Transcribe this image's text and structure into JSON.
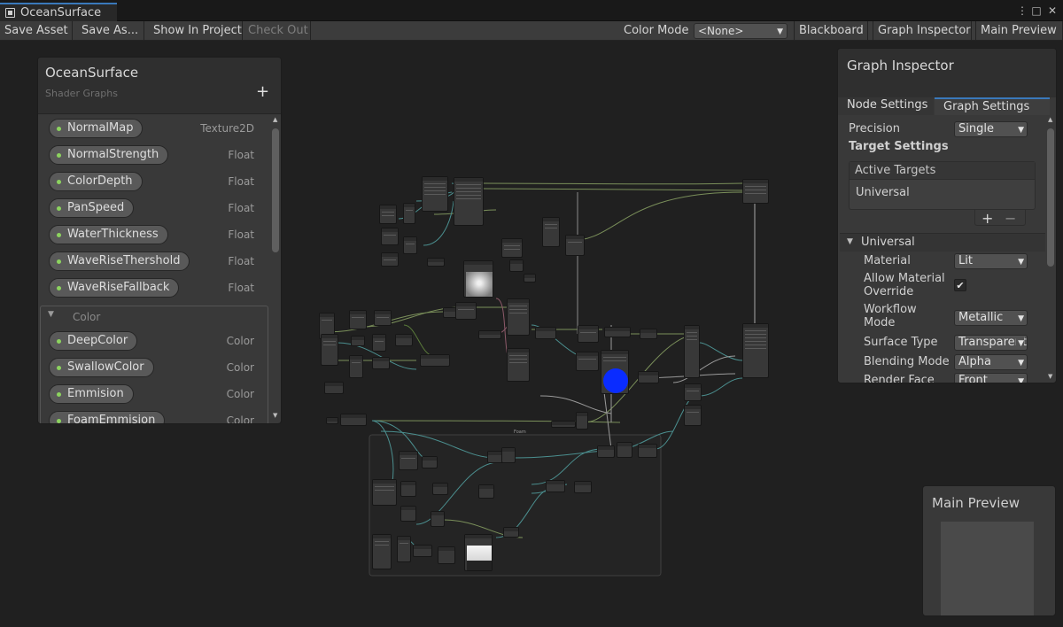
{
  "window": {
    "title": "OceanSurface",
    "controls": {
      "menu": "⋮",
      "maximize": "□",
      "close": "✕"
    }
  },
  "toolbar": {
    "save_asset": "Save Asset",
    "save_as": "Save As...",
    "show_in_project": "Show In Project",
    "check_out": "Check Out",
    "color_mode_label": "Color Mode",
    "color_mode_value": "<None>",
    "blackboard": "Blackboard",
    "graph_inspector": "Graph Inspector",
    "main_preview": "Main Preview"
  },
  "blackboard": {
    "title": "OceanSurface",
    "subtitle": "Shader Graphs",
    "add": "+",
    "properties": [
      {
        "name": "NormalMap",
        "type": "Texture2D"
      },
      {
        "name": "NormalStrength",
        "type": "Float"
      },
      {
        "name": "ColorDepth",
        "type": "Float"
      },
      {
        "name": "PanSpeed",
        "type": "Float"
      },
      {
        "name": "WaterThickness",
        "type": "Float"
      },
      {
        "name": "WaveRiseThershold",
        "type": "Float"
      },
      {
        "name": "WaveRiseFallback",
        "type": "Float"
      }
    ],
    "category": {
      "name": "Color",
      "properties": [
        {
          "name": "DeepColor",
          "type": "Color"
        },
        {
          "name": "SwallowColor",
          "type": "Color"
        },
        {
          "name": "Emmision",
          "type": "Color"
        },
        {
          "name": "FoamEmmision",
          "type": "Color"
        }
      ]
    }
  },
  "inspector": {
    "title": "Graph Inspector",
    "tabs": [
      "Node Settings",
      "Graph Settings"
    ],
    "active_tab": "Graph Settings",
    "precision_label": "Precision",
    "precision_value": "Single",
    "target_settings": "Target Settings",
    "active_targets": "Active Targets",
    "targets": [
      "Universal"
    ],
    "add": "+",
    "remove": "−",
    "section": "Universal",
    "material_label": "Material",
    "material_value": "Lit",
    "allow_override_label": "Allow Material Override",
    "allow_override_checked": "✔",
    "workflow_label": "Workflow Mode",
    "workflow_value": "Metallic",
    "surface_label": "Surface Type",
    "surface_value": "Transparent",
    "blending_label": "Blending Mode",
    "blending_value": "Alpha",
    "render_face_label": "Render Face",
    "render_face_value": "Front"
  },
  "preview": {
    "title": "Main Preview"
  },
  "graph": {
    "group_title": "Foam",
    "colors": {
      "wire_green": "#7a8f5a",
      "wire_teal": "#4b8f8f",
      "preview_blue": "#0a2cff"
    }
  }
}
